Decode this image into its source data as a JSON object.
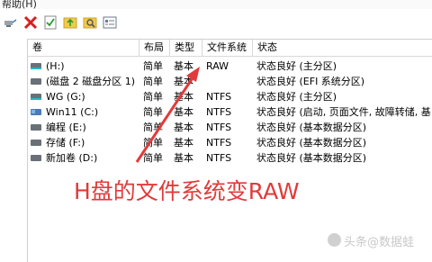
{
  "menu": {
    "help_label": "帮助(H)"
  },
  "toolbar": {
    "buttons": [
      {
        "name": "connect-icon"
      },
      {
        "name": "delete-icon"
      },
      {
        "name": "check-icon"
      },
      {
        "name": "folder-up-icon"
      },
      {
        "name": "search-folder-icon"
      },
      {
        "name": "properties-icon"
      }
    ]
  },
  "table": {
    "headers": [
      "卷",
      "布局",
      "类型",
      "文件系统",
      "状态"
    ],
    "rows": [
      {
        "volume": "(H:)",
        "layout": "简单",
        "type": "基本",
        "fs": "RAW",
        "status": "状态良好 (主分区)",
        "icon": "cyan"
      },
      {
        "volume": "(磁盘 2 磁盘分区 1)",
        "layout": "简单",
        "type": "基本",
        "fs": "",
        "status": "状态良好 (EFI 系统分区)",
        "icon": "plain"
      },
      {
        "volume": "WG (G:)",
        "layout": "简单",
        "type": "基本",
        "fs": "NTFS",
        "status": "状态良好 (主分区)",
        "icon": "cyan"
      },
      {
        "volume": "Win11 (C:)",
        "layout": "简单",
        "type": "基本",
        "fs": "NTFS",
        "status": "状态良好 (启动, 页面文件, 故障转储, 基",
        "icon": "win"
      },
      {
        "volume": "编程 (E:)",
        "layout": "简单",
        "type": "基本",
        "fs": "NTFS",
        "status": "状态良好 (基本数据分区)",
        "icon": "plain"
      },
      {
        "volume": "存储 (F:)",
        "layout": "简单",
        "type": "基本",
        "fs": "NTFS",
        "status": "状态良好 (基本数据分区)",
        "icon": "plain"
      },
      {
        "volume": "新加卷 (D:)",
        "layout": "简单",
        "type": "基本",
        "fs": "NTFS",
        "status": "状态良好 (基本数据分区)",
        "icon": "plain"
      }
    ]
  },
  "annotation": {
    "text": "H盘的文件系统变RAW"
  },
  "watermark": {
    "text": "头条@数据蛙"
  },
  "colors": {
    "annotation_red": "#e23a3a",
    "disk_cyan": "#28b6c8"
  }
}
